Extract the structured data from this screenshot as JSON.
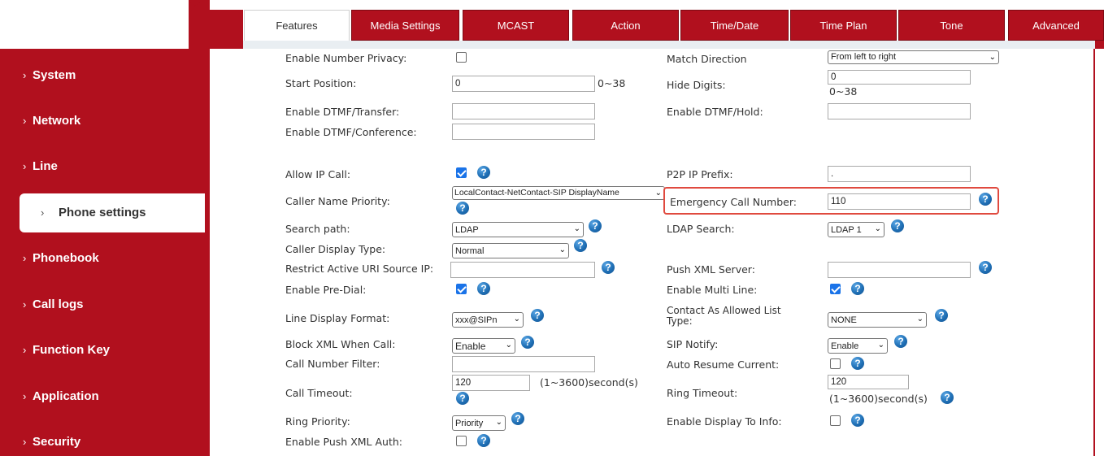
{
  "sidebar": {
    "items": [
      {
        "label": "System"
      },
      {
        "label": "Network"
      },
      {
        "label": "Line"
      },
      {
        "label": "Phone settings",
        "active": true
      },
      {
        "label": "Phonebook"
      },
      {
        "label": "Call logs"
      },
      {
        "label": "Function Key"
      },
      {
        "label": "Application"
      },
      {
        "label": "Security"
      }
    ]
  },
  "tabs": [
    {
      "label": "Features",
      "active": true
    },
    {
      "label": "Media Settings"
    },
    {
      "label": "MCAST"
    },
    {
      "label": "Action"
    },
    {
      "label": "Time/Date"
    },
    {
      "label": "Time Plan"
    },
    {
      "label": "Tone"
    },
    {
      "label": "Advanced"
    }
  ],
  "left": {
    "number_privacy": "Enable Number Privacy:",
    "start_position": "Start Position:",
    "start_position_value": "0",
    "start_position_range": "0~38",
    "dtmf_transfer": "Enable DTMF/Transfer:",
    "dtmf_conference": "Enable DTMF/Conference:",
    "allow_ip_call": "Allow IP Call:",
    "caller_name_priority": "Caller Name Priority:",
    "caller_name_priority_value": "LocalContact-NetContact-SIP DisplayName",
    "search_path": "Search path:",
    "search_path_value": "LDAP",
    "caller_display_type": "Caller Display Type:",
    "caller_display_type_value": "Normal",
    "restrict_uri": "Restrict Active URI Source IP:",
    "pre_dial": "Enable Pre-Dial:",
    "line_display_format": "Line Display Format:",
    "line_display_format_value": "xxx@SIPn",
    "block_xml": "Block XML When Call:",
    "block_xml_value": "Enable",
    "call_number_filter": "Call Number Filter:",
    "call_timeout": "Call Timeout:",
    "call_timeout_value": "120",
    "call_timeout_range": "(1~3600)second(s)",
    "ring_priority": "Ring Priority:",
    "ring_priority_value": "Priority",
    "push_xml_auth": "Enable Push XML Auth:"
  },
  "right": {
    "match_direction": "Match Direction",
    "match_direction_value": "From left to right",
    "hide_digits": "Hide Digits:",
    "hide_digits_value": "0",
    "hide_digits_range": "0~38",
    "dtmf_hold": "Enable DTMF/Hold:",
    "p2p_prefix": "P2P IP Prefix:",
    "p2p_prefix_value": ".",
    "emergency_number": "Emergency Call Number:",
    "emergency_number_value": "110",
    "ldap_search": "LDAP Search:",
    "ldap_search_value": "LDAP 1",
    "push_xml_server": "Push XML Server:",
    "multi_line": "Enable Multi Line:",
    "contact_allowed": "Contact As Allowed List Type:",
    "contact_allowed_value": "NONE",
    "sip_notify": "SIP Notify:",
    "sip_notify_value": "Enable",
    "auto_resume": "Auto Resume Current:",
    "ring_timeout": "Ring Timeout:",
    "ring_timeout_value": "120",
    "ring_timeout_range": "(1~3600)second(s)",
    "display_to_info": "Enable Display To Info:"
  },
  "help_glyph": "?",
  "caret_glyph": "⌄",
  "chevron_glyph": "›",
  "colors": {
    "brand_red": "#b1101e",
    "help_blue": "#1f6fb5",
    "highlight": "#e04a3f"
  }
}
